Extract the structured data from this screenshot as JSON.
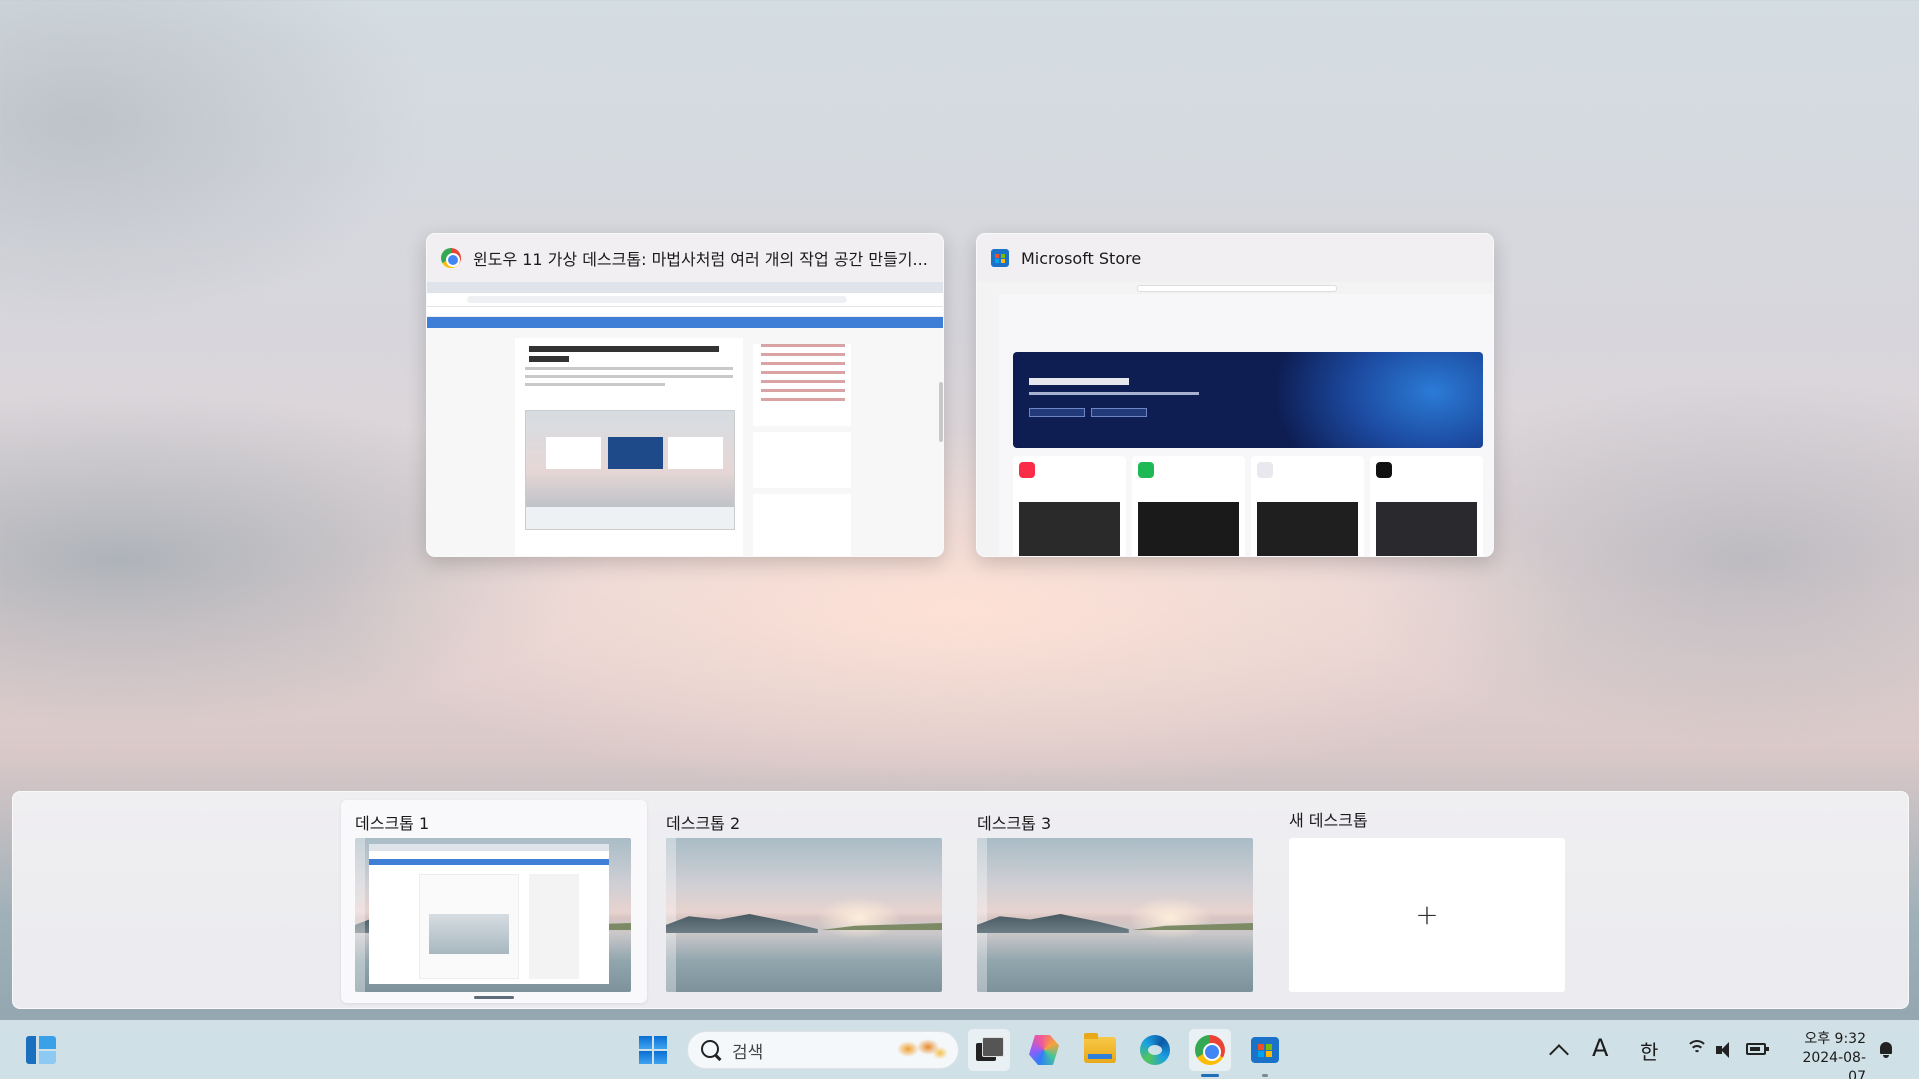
{
  "windows": [
    {
      "title": "윈도우 11 가상 데스크톱: 마법사처럼 여러 개의 작업 공간 만들기...",
      "app": "chrome"
    },
    {
      "title": "Microsoft Store",
      "app": "microsoft-store"
    }
  ],
  "desktops": [
    {
      "label": "데스크톱 1",
      "selected": true
    },
    {
      "label": "데스크톱 2",
      "selected": false
    },
    {
      "label": "데스크톱 3",
      "selected": false
    }
  ],
  "new_desktop": {
    "label": "새 데스크톱",
    "plus": "+"
  },
  "taskbar": {
    "search_text": "검색",
    "pinned": [
      "widgets-icon",
      "start-icon",
      "task-view-icon",
      "copilot-icon",
      "file-explorer-icon",
      "edge-icon",
      "chrome-icon",
      "microsoft-store-icon"
    ]
  },
  "tray": {
    "font_indicator": "A",
    "ime": "한",
    "time": "오후 9:32",
    "date": "2024-08-07"
  }
}
